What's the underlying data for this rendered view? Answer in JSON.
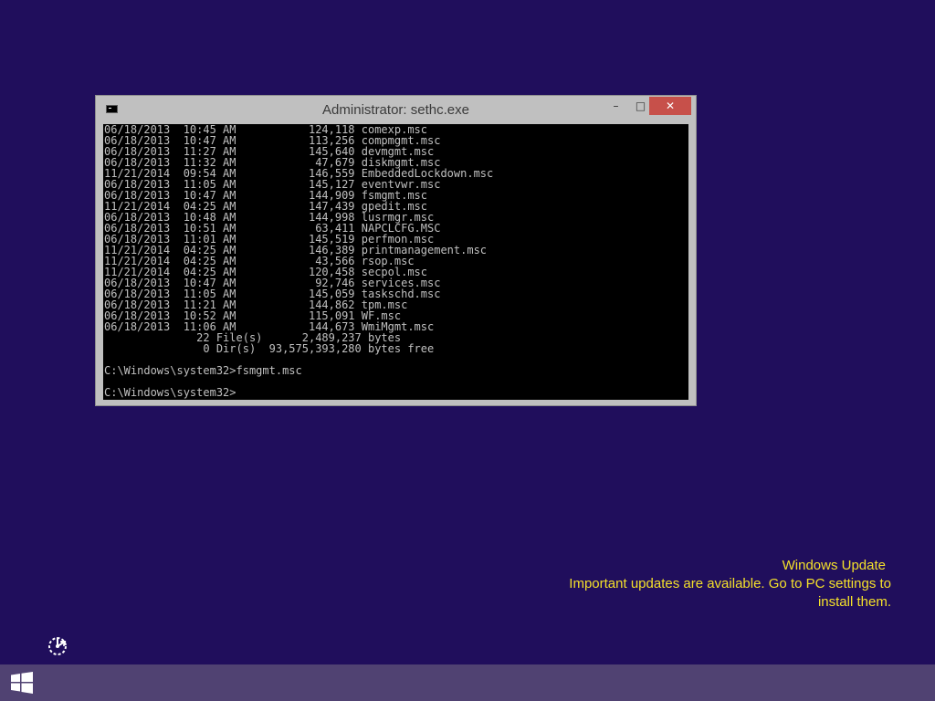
{
  "window": {
    "title": "Administrator: sethc.exe",
    "minimize_label": "–",
    "maximize_label": "□",
    "close_label": "✕"
  },
  "console": {
    "lines": [
      "06/18/2013  10:45 AM           124,118 comexp.msc",
      "06/18/2013  10:47 AM           113,256 compmgmt.msc",
      "06/18/2013  11:27 AM           145,640 devmgmt.msc",
      "06/18/2013  11:32 AM            47,679 diskmgmt.msc",
      "11/21/2014  09:54 AM           146,559 EmbeddedLockdown.msc",
      "06/18/2013  11:05 AM           145,127 eventvwr.msc",
      "06/18/2013  10:47 AM           144,909 fsmgmt.msc",
      "11/21/2014  04:25 AM           147,439 gpedit.msc",
      "06/18/2013  10:48 AM           144,998 lusrmgr.msc",
      "06/18/2013  10:51 AM            63,411 NAPCLCFG.MSC",
      "06/18/2013  11:01 AM           145,519 perfmon.msc",
      "11/21/2014  04:25 AM           146,389 printmanagement.msc",
      "11/21/2014  04:25 AM            43,566 rsop.msc",
      "11/21/2014  04:25 AM           120,458 secpol.msc",
      "06/18/2013  10:47 AM            92,746 services.msc",
      "06/18/2013  11:05 AM           145,059 taskschd.msc",
      "06/18/2013  11:21 AM           144,862 tpm.msc",
      "06/18/2013  10:52 AM           115,091 WF.msc",
      "06/18/2013  11:06 AM           144,673 WmiMgmt.msc",
      "              22 File(s)      2,489,237 bytes",
      "               0 Dir(s)  93,575,393,280 bytes free",
      "",
      "C:\\Windows\\system32>fsmgmt.msc",
      "",
      "C:\\Windows\\system32>"
    ]
  },
  "notification": {
    "title": "Windows Update",
    "line1": "Important updates are available. Go to PC settings to",
    "line2": "install them."
  },
  "colors": {
    "background": "#200e5c",
    "taskbar": "#504272",
    "notification_text": "#f4e02a",
    "close_button": "#c7504a"
  },
  "icons": {
    "ease_of_access": "ease-of-access-icon",
    "start": "windows-logo-icon",
    "console_app": "cmd-icon"
  }
}
